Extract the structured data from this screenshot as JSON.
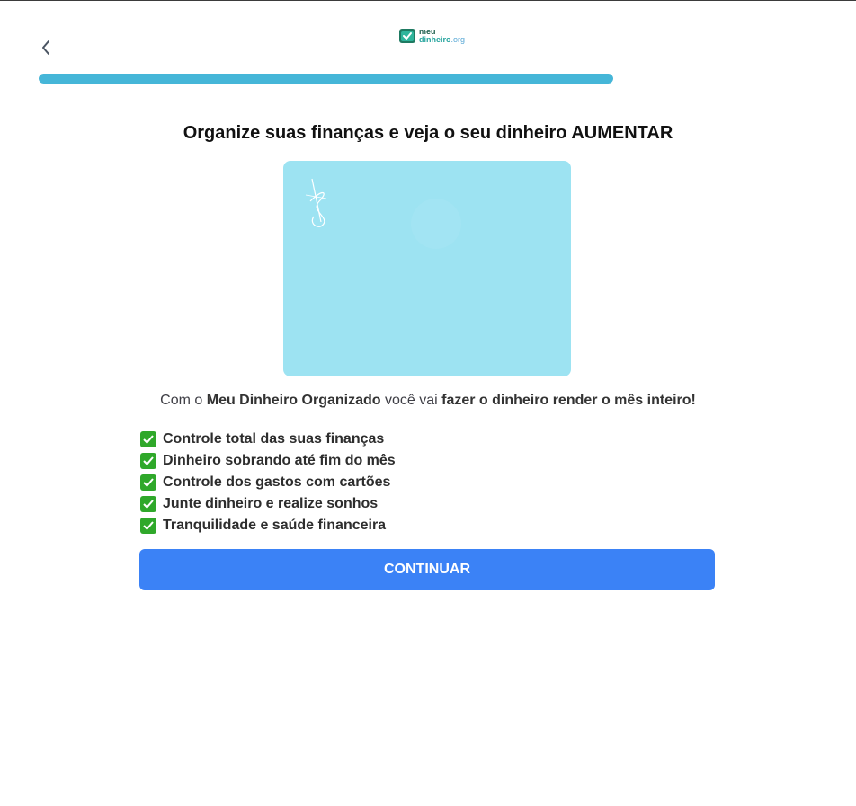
{
  "header": {
    "logo": {
      "line1": "meu",
      "line2_brand": "dinheiro",
      "line2_suffix": ".org"
    },
    "back_icon": "chevron-left-icon"
  },
  "progress": {
    "value_percent": 100
  },
  "main": {
    "headline": "Organize suas finanças e veja o seu dinheiro AUMENTAR",
    "hero_image": "money-illustration",
    "subtitle": {
      "part1": "Com o ",
      "bold1": "Meu Dinheiro Organizado",
      "part2": " você vai ",
      "bold2": "fazer o dinheiro render o mês inteiro!"
    },
    "benefits": [
      "Controle total das suas finanças",
      "Dinheiro sobrando até fim do mês",
      "Controle dos gastos com cartões",
      "Junte dinheiro e realize sonhos",
      "Tranquilidade e saúde financeira"
    ],
    "continue_label": "CONTINUAR"
  },
  "colors": {
    "progress": "#45b6d8",
    "button": "#3b82f6",
    "hero_bg": "#9de3f2",
    "check": "#2fa82a"
  }
}
